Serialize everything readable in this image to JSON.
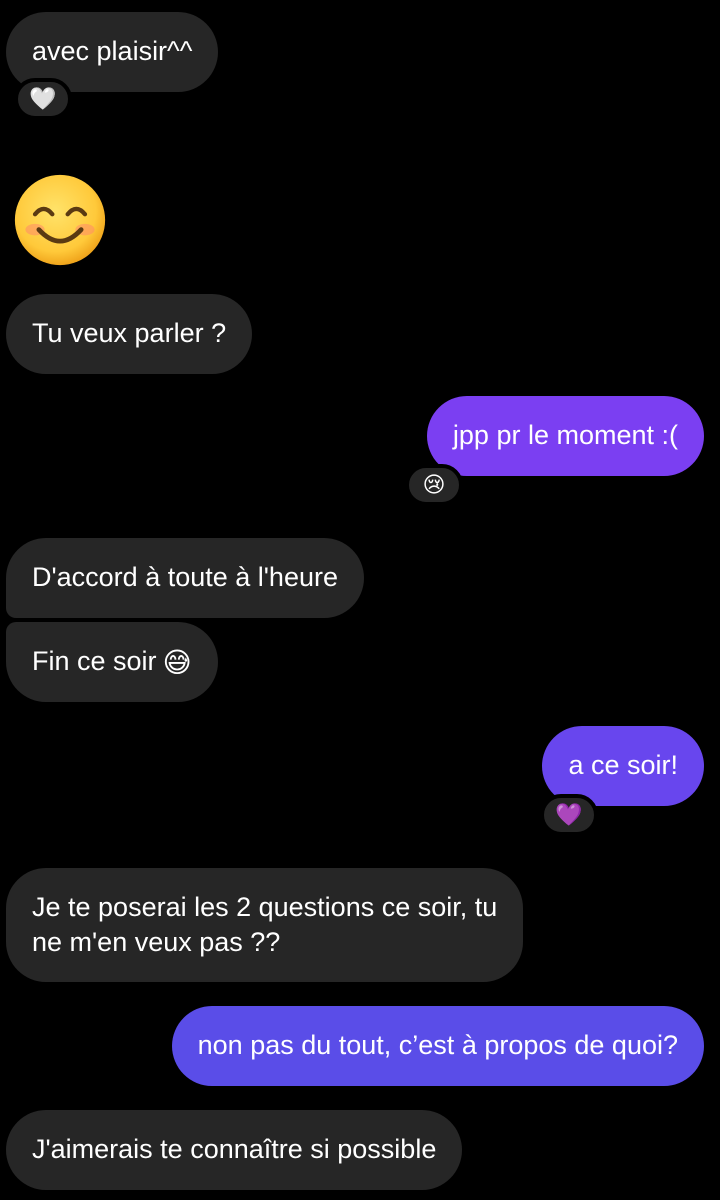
{
  "messages": {
    "m1": {
      "text": "avec plaisir^^",
      "reaction": "🤍"
    },
    "m2": {
      "emoji_name": "smiling-face-emoji"
    },
    "m3": {
      "text": "Tu veux parler ?"
    },
    "m4": {
      "text": "jpp pr le moment :(",
      "reaction": "😢"
    },
    "m5": {
      "text": "D'accord à toute à l'heure"
    },
    "m6": {
      "text": "Fin ce soir",
      "emoji": "😅"
    },
    "m7": {
      "text": "a ce soir!",
      "reaction": "💜"
    },
    "m8": {
      "line1": "Je te poserai les 2 questions ce soir, tu",
      "line2": "ne m'en veux pas ??"
    },
    "m9": {
      "text": "non pas du tout, c’est à propos de quoi?"
    },
    "m10": {
      "text": "J'aimerais te connaître si possible"
    }
  },
  "colors": {
    "background": "#000000",
    "incoming_bubble": "#262626",
    "outgoing_purple": "#7b3ff2",
    "outgoing_blue": "#5a4de8"
  }
}
